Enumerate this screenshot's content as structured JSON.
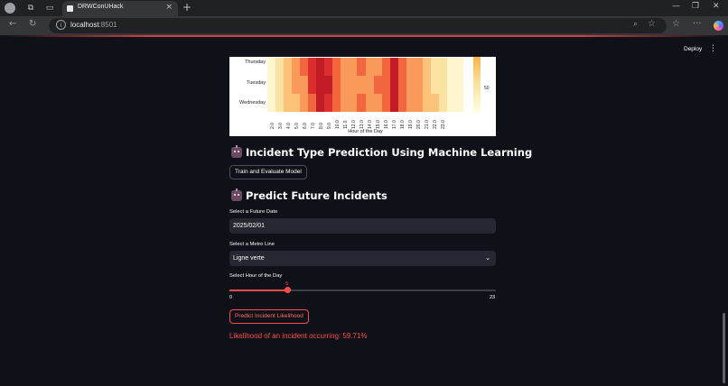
{
  "browser": {
    "tab_title": "DRWConUHack",
    "url_host": "localhost",
    "url_port": ":8501"
  },
  "app": {
    "deploy_label": "Deploy",
    "colors": {
      "accent": "#ff4b4b",
      "background": "#0e1117",
      "input_bg": "#262730"
    }
  },
  "heatmap": {
    "rows": [
      "Thursday",
      "Tuesday",
      "Wednesday"
    ],
    "columns": [
      "2.0",
      "3.0",
      "4.0",
      "5.0",
      "6.0",
      "7.0",
      "8.0",
      "9.0",
      "10.0",
      "11.0",
      "12.0",
      "13.0",
      "14.0",
      "15.0",
      "16.0",
      "17.0",
      "18.0",
      "19.0",
      "20.0",
      "21.0",
      "22.0",
      "23.0"
    ],
    "xlabel": "Hour of the Day",
    "colorbar_ticks": [
      "50"
    ]
  },
  "section_ml": {
    "title": "Incident Type Prediction Using Machine Learning",
    "button_label": "Train and Evaluate Model",
    "icon": "robot-icon"
  },
  "section_predict": {
    "title": "Predict Future Incidents",
    "icon": "robot-icon",
    "date_label": "Select a Future Date",
    "date_value": "2025/02/01",
    "line_label": "Select a Metro Line",
    "line_value": "Ligne verte",
    "hour_label": "Select Hour of the Day",
    "hour_value": "5",
    "hour_value_num": 5,
    "hour_min": "0",
    "hour_max": "23",
    "hour_min_num": 0,
    "hour_max_num": 23,
    "predict_button": "Predict Incident Likelihood",
    "result_text": "Likelihood of an incident occurring: 59.71%"
  }
}
